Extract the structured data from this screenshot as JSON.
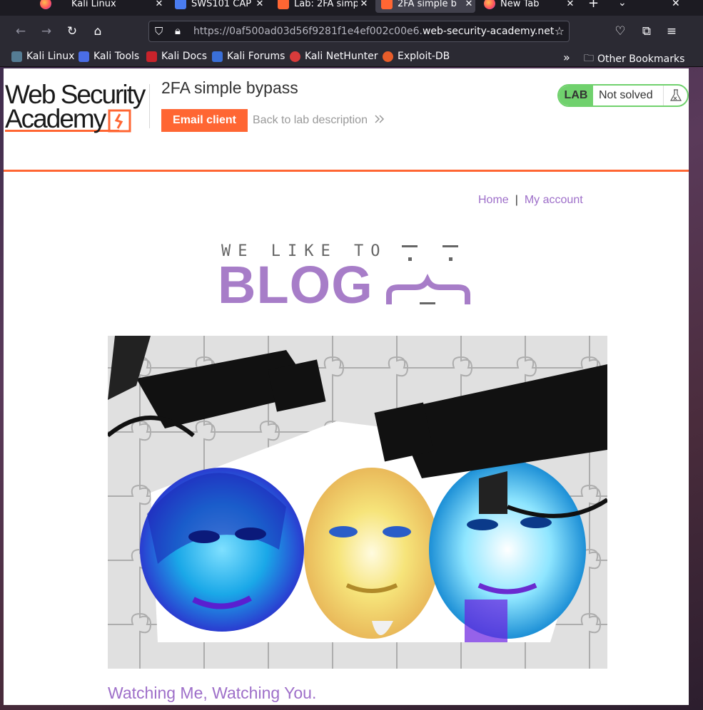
{
  "browser": {
    "tabs": [
      {
        "title": "",
        "active": false
      },
      {
        "title": "Kali Linux",
        "active": false
      },
      {
        "title": "SWS101 CAP",
        "active": false
      },
      {
        "title": "Lab: 2FA simp",
        "active": false
      },
      {
        "title": "2FA simple b",
        "active": true
      },
      {
        "title": "New Tab",
        "active": false
      }
    ],
    "url_prefix": "https://0af500ad03d56f9281f1e4ef002c00e6.",
    "url_domain": "web-security-academy.net",
    "bookmarks": [
      "Kali Linux",
      "Kali Tools",
      "Kali Docs",
      "Kali Forums",
      "Kali NetHunter",
      "Exploit-DB"
    ],
    "other_bookmarks": "Other Bookmarks"
  },
  "header": {
    "logo_line1": "Web Security",
    "logo_line2": "Academy",
    "lab_title": "2FA simple bypass",
    "email_client": "Email client",
    "back_link": "Back to lab description",
    "lab_label": "LAB",
    "lab_status": "Not solved"
  },
  "nav": {
    "home": "Home",
    "separator": "|",
    "my_account": "My account"
  },
  "hero": {
    "tagline": "WE LIKE TO",
    "word": "BLOG"
  },
  "post": {
    "title": "Watching Me, Watching You."
  },
  "colors": {
    "accent_orange": "#ff6633",
    "link_purple": "#9e6fc9",
    "lab_green": "#70d16d"
  }
}
